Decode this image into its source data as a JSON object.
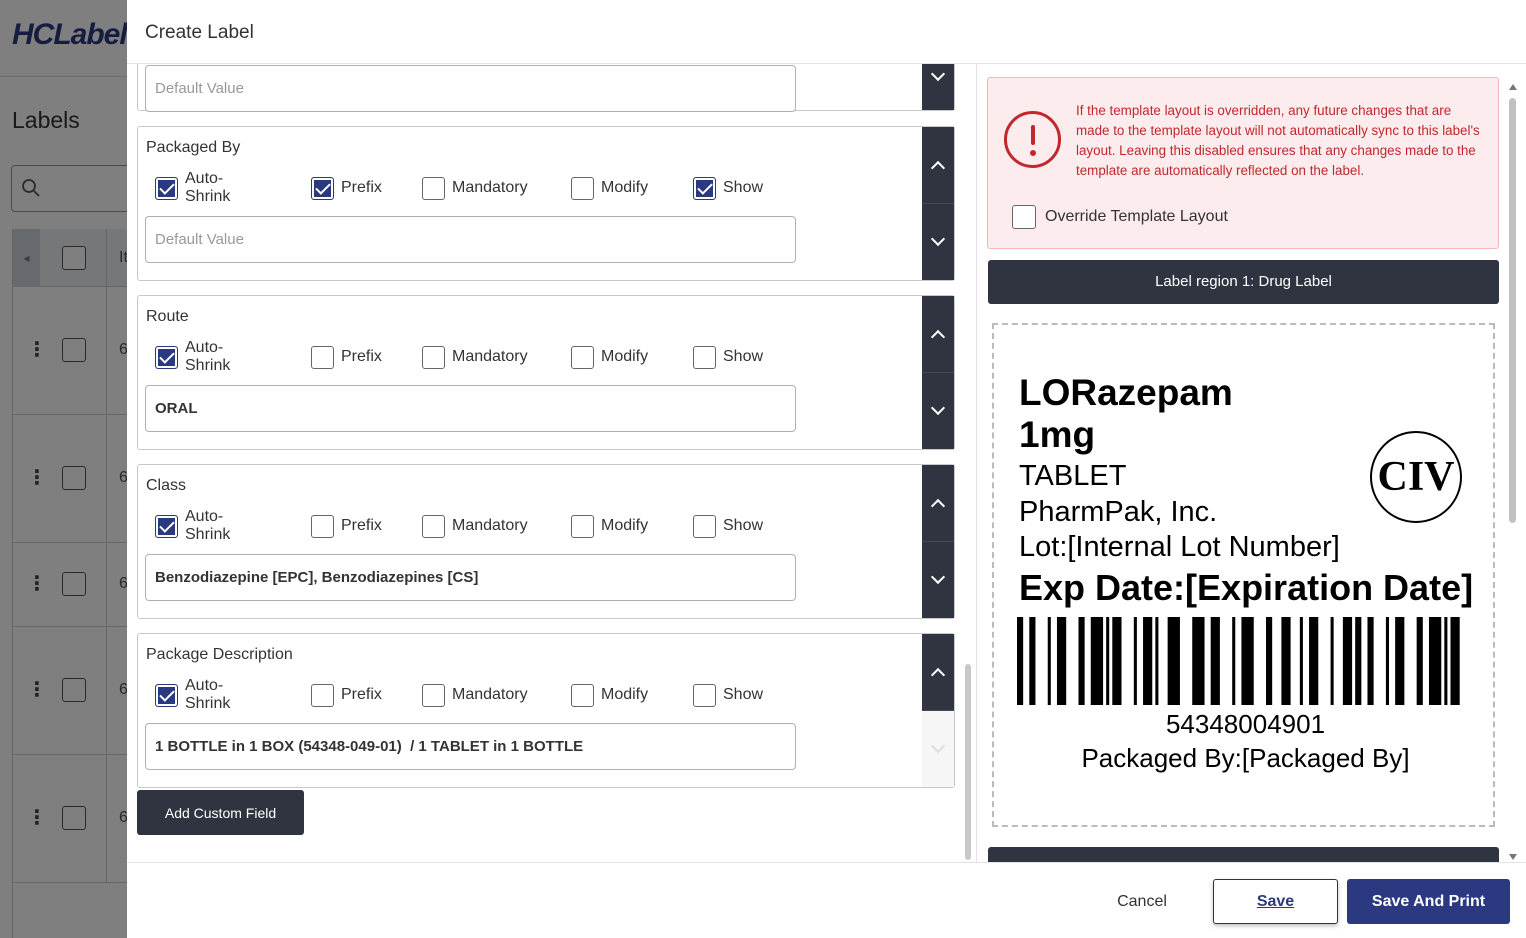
{
  "background": {
    "logo": "HCLabel",
    "page_title": "Labels",
    "column_header_partial": "It",
    "row_cell_partial": "6"
  },
  "drawer": {
    "title": "Create Label"
  },
  "fields": [
    {
      "label": "",
      "value": "",
      "placeholder": "Default Value",
      "partial": true
    },
    {
      "label": "Packaged By",
      "options": {
        "auto_shrink": true,
        "prefix": true,
        "mandatory": false,
        "modify": false,
        "show": true
      },
      "value": "",
      "placeholder": "Default Value"
    },
    {
      "label": "Route",
      "options": {
        "auto_shrink": true,
        "prefix": false,
        "mandatory": false,
        "modify": false,
        "show": false
      },
      "value": "ORAL",
      "placeholder": "Default Value"
    },
    {
      "label": "Class",
      "options": {
        "auto_shrink": true,
        "prefix": false,
        "mandatory": false,
        "modify": false,
        "show": false
      },
      "value": "Benzodiazepine [EPC], Benzodiazepines [CS]",
      "placeholder": "Default Value"
    },
    {
      "label": "Package Description",
      "options": {
        "auto_shrink": true,
        "prefix": false,
        "mandatory": false,
        "modify": false,
        "show": false
      },
      "value": "1 BOTTLE in 1 BOX (54348-049-01)  / 1 TABLET in 1 BOTTLE",
      "placeholder": "Default Value"
    }
  ],
  "option_labels": {
    "auto_shrink": "Auto-Shrink",
    "prefix": "Prefix",
    "mandatory": "Mandatory",
    "modify": "Modify",
    "show": "Show"
  },
  "add_custom_field_label": "Add Custom Field",
  "warning": {
    "text": "If the template layout is overridden, any future changes that are made to the template layout will not automatically sync to this label's layout. Leaving this disabled ensures that any changes made to the template are automatically reflected on the label.",
    "override_label": "Override Template Layout",
    "override_checked": false,
    "color": "#c1272d"
  },
  "region": {
    "title": "Label region 1: Drug Label"
  },
  "label_preview": {
    "drug_name": "LORazepam",
    "strength": "1mg",
    "dosage_form": "TABLET",
    "manufacturer": "PharmPak, Inc.",
    "lot": "Lot:[Internal Lot Number]",
    "expiration": "Exp Date:[Expiration Date]",
    "schedule": "CIV",
    "ndc": "54348004901",
    "packaged_by": "Packaged By:[Packaged By]"
  },
  "footer": {
    "cancel": "Cancel",
    "save": "Save",
    "save_and_print": "Save And Print"
  },
  "colors": {
    "primary": "#2b3a80",
    "dark": "#2f3440",
    "warning_bg": "#fdeced"
  }
}
